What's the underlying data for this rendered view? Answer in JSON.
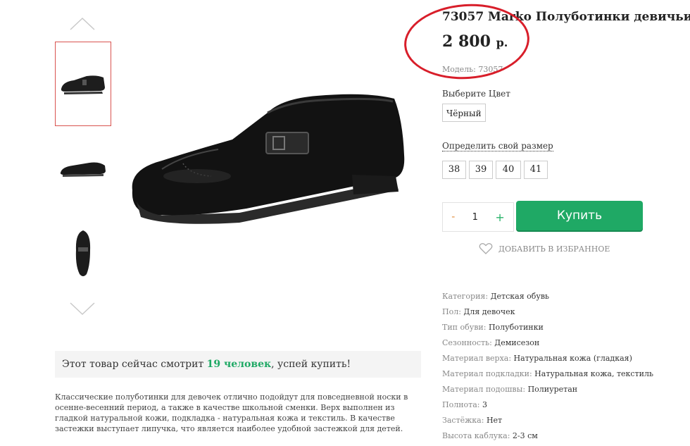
{
  "product": {
    "title": "73057 Marko Полуботинки девичьи",
    "price": "2 800",
    "currency": "р.",
    "model_label": "Модель:",
    "model_value": "73057"
  },
  "color": {
    "label": "Выберите Цвет",
    "selected": "Чёрный"
  },
  "size": {
    "link": "Определить свой размер",
    "options": [
      "38",
      "39",
      "40",
      "41"
    ]
  },
  "cart": {
    "minus": "-",
    "quantity": "1",
    "plus": "+",
    "buy_label": "Купить",
    "favorite_label": "ДОБАВИТЬ В ИЗБРАННОЕ"
  },
  "viewers": {
    "prefix": "Этот товар сейчас смотрит ",
    "count": "19 человек",
    "suffix": ", успей купить!"
  },
  "description": "Классические полуботинки для девочек отлично подойдут для повседневной носки в осенне-весенний период, а также в качестве школьной сменки. Верх выполнен из гладкой натуральной кожи, подкладка - натуральная кожа и текстиль. В качестве застежки выступает липучка, что является наиболее удобной застежкой для детей.",
  "specs": [
    {
      "k": "Категория:",
      "v": "Детская обувь"
    },
    {
      "k": "Пол:",
      "v": "Для девочек"
    },
    {
      "k": "Тип обуви:",
      "v": "Полуботинки"
    },
    {
      "k": "Сезонность:",
      "v": "Демисезон"
    },
    {
      "k": "Материал верха:",
      "v": "Натуральная кожа (гладкая)"
    },
    {
      "k": "Материал подкладки:",
      "v": "Натуральная кожа, текстиль"
    },
    {
      "k": "Материал подошвы:",
      "v": "Полиуретан"
    },
    {
      "k": "Полнота:",
      "v": "3"
    },
    {
      "k": "Застёжка:",
      "v": "Нет"
    },
    {
      "k": "Высота каблука:",
      "v": "2-3 см"
    }
  ],
  "icons": {
    "up": "chevron-up-icon",
    "down": "chevron-down-icon",
    "favorite": "heart-icon"
  },
  "colors": {
    "accent": "#1fa965",
    "annotation": "#d81e2a"
  }
}
